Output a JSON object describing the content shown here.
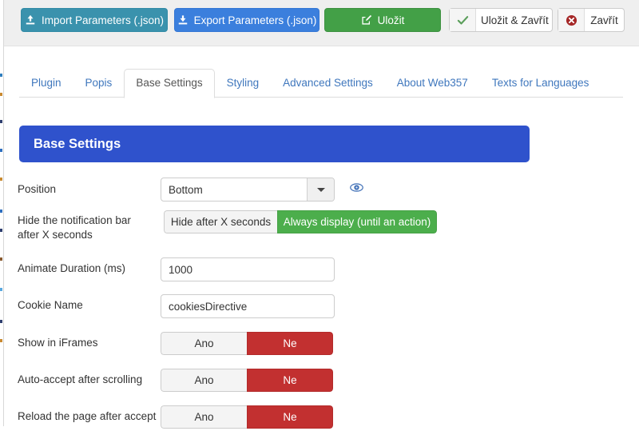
{
  "toolbar": {
    "buttons": [
      {
        "name": "import",
        "label": "Import Parameters (.json)",
        "icon": "upload-icon"
      },
      {
        "name": "export",
        "label": "Export Parameters (.json)",
        "icon": "download-icon"
      },
      {
        "name": "save",
        "label": "Uložit",
        "icon": "edit-icon"
      },
      {
        "name": "save-close",
        "label": "Uložit & Zavřít",
        "icon": "check-icon"
      },
      {
        "name": "close",
        "label": "Zavřít",
        "icon": "cancel-circle-icon"
      }
    ]
  },
  "tabs": [
    {
      "label": "Plugin",
      "active": false
    },
    {
      "label": "Popis",
      "active": false
    },
    {
      "label": "Base Settings",
      "active": true
    },
    {
      "label": "Styling",
      "active": false
    },
    {
      "label": "Advanced Settings",
      "active": false
    },
    {
      "label": "About Web357",
      "active": false
    },
    {
      "label": "Texts for Languages",
      "active": false
    }
  ],
  "panel": {
    "title": "Base Settings"
  },
  "form": {
    "position": {
      "label": "Position",
      "value": "Bottom",
      "preview_icon": "eye-icon"
    },
    "hide_bar": {
      "label": "Hide the notification bar after X seconds",
      "option_a": "Hide after X seconds",
      "option_b": "Always display (until an action)",
      "selected": "option_b"
    },
    "animate_duration": {
      "label": "Animate Duration (ms)",
      "value": "1000",
      "placeholder": ""
    },
    "cookie_name": {
      "label": "Cookie Name",
      "value": "cookiesDirective",
      "placeholder": ""
    },
    "show_in_iframes": {
      "label": "Show in iFrames",
      "option_a": "Ano",
      "option_b": "Ne",
      "selected": "option_b"
    },
    "auto_accept_scroll": {
      "label": "Auto-accept after scrolling",
      "option_a": "Ano",
      "option_b": "Ne",
      "selected": "option_b"
    },
    "reload_after_accept": {
      "label": "Reload the page after accept",
      "option_a": "Ano",
      "option_b": "Ne",
      "selected": "option_b"
    }
  },
  "colors": {
    "panel_blue": "#2f52cc",
    "import_teal": "#3a92ad",
    "export_blue": "#3b7fdd",
    "save_green": "#43a047",
    "toggle_green": "#4cae4c",
    "toggle_red": "#c23030",
    "tab_link": "#3f77bd",
    "toolbar_bg": "#efefef"
  }
}
